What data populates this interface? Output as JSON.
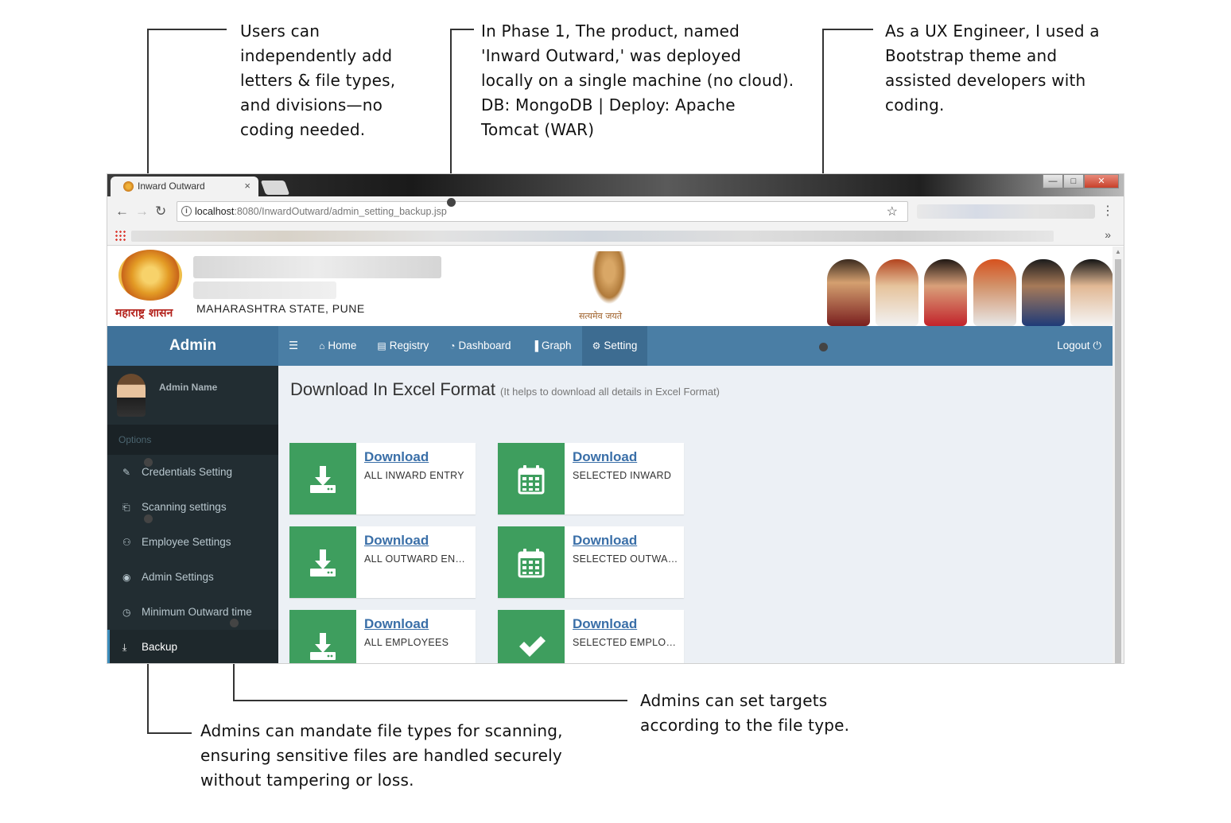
{
  "annotations": {
    "users_add": "Users can\nindependently add\nletters & file types,\nand divisions—no\ncoding needed.",
    "phase1": "In Phase 1, The product, named\n'Inward Outward,' was deployed\nlocally on a single machine (no cloud).\nDB: MongoDB | Deploy: Apache\nTomcat (WAR)",
    "ux_engineer": "As a UX Engineer, I used a\nBootstrap theme and\nassisted developers with\ncoding.",
    "targets": "Admins can set targets\naccording to the file type.",
    "mandate": "Admins can mandate file types for scanning,\nensuring sensitive files are handled securely\nwithout tampering or loss."
  },
  "browser": {
    "tab_title": "Inward Outward",
    "tab_close": "×",
    "url_host": "localhost",
    "url_path": ":8080/InwardOutward/admin_setting_backup.jsp",
    "more_bookmarks": "»"
  },
  "banner": {
    "seal_caption": "महाराष्ट्र शासन",
    "state": "MAHARASHTRA STATE, PUNE",
    "emblem_caption": "सत्यमेव जयते"
  },
  "topnav": {
    "brand": "Admin",
    "items": [
      {
        "label": "Home",
        "icon": "home-icon",
        "glyph": "⌂"
      },
      {
        "label": "Registry",
        "icon": "book-icon",
        "glyph": "▤"
      },
      {
        "label": "Dashboard",
        "icon": "dashboard-icon",
        "glyph": "◔"
      },
      {
        "label": "Graph",
        "icon": "bar-chart-icon",
        "glyph": "▐"
      },
      {
        "label": "Setting",
        "icon": "gear-icon",
        "glyph": "⚙"
      }
    ],
    "logout": "Logout",
    "logout_glyph": "⏻"
  },
  "sidebar": {
    "user_name": "Admin Name",
    "options_header": "Options",
    "items": [
      {
        "label": "Credentials Setting",
        "icon": "edit-icon",
        "glyph": "✎"
      },
      {
        "label": "Scanning settings",
        "icon": "file-pdf-icon",
        "glyph": "⎗"
      },
      {
        "label": "Employee Settings",
        "icon": "users-icon",
        "glyph": "⚇"
      },
      {
        "label": "Admin Settings",
        "icon": "user-circle-icon",
        "glyph": "◉"
      },
      {
        "label": "Minimum Outward time",
        "icon": "clock-icon",
        "glyph": "◷"
      },
      {
        "label": "Backup",
        "icon": "download-icon",
        "glyph": "⤓"
      }
    ]
  },
  "content": {
    "title": "Download In Excel Format",
    "subtitle": "(It helps to download all details in Excel Format)",
    "cards": [
      {
        "link": "Download",
        "desc": "ALL INWARD ENTRY",
        "icon": "download-icon"
      },
      {
        "link": "Download",
        "desc": "SELECTED INWARD",
        "icon": "calendar-icon"
      },
      {
        "link": "Download",
        "desc": "ALL OUTWARD ENTRY",
        "icon": "download-icon"
      },
      {
        "link": "Download",
        "desc": "SELECTED OUTWARD",
        "icon": "calendar-icon"
      },
      {
        "link": "Download",
        "desc": "ALL EMPLOYEES",
        "icon": "download-icon"
      },
      {
        "link": "Download",
        "desc": "SELECTED EMPLOYEES",
        "icon": "check-icon"
      }
    ]
  },
  "colors": {
    "nav": "#4a7ea5",
    "sidebar": "#222d32",
    "card_icon": "#3e9e5e",
    "link": "#3a6fa8",
    "page_bg": "#ecf0f5"
  }
}
